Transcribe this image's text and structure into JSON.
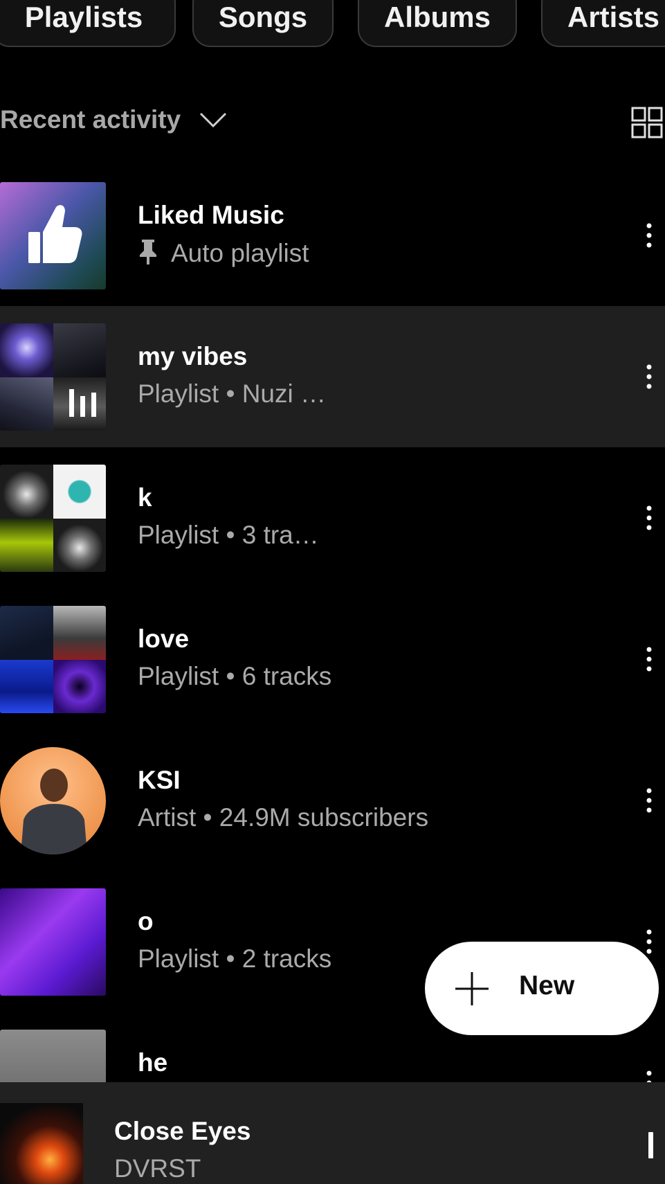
{
  "chips": [
    "Playlists",
    "Songs",
    "Albums",
    "Artists"
  ],
  "section": {
    "sort_label": "Recent activity"
  },
  "items": [
    {
      "title": "Liked Music",
      "subtitle": "Auto playlist",
      "thumb": "liked"
    },
    {
      "title": "my vibes",
      "subtitle": "Playlist • Nuzi …",
      "thumb": "collage-purple",
      "now_playing": true
    },
    {
      "title": "k",
      "subtitle": "Playlist • 3 tra…",
      "thumb": "collage-cyan"
    },
    {
      "title": "love",
      "subtitle": "Playlist • 6 tracks",
      "thumb": "collage-blue"
    },
    {
      "title": "KSI",
      "subtitle": "Artist • 24.9M subscribers",
      "thumb": "artist"
    },
    {
      "title": "o",
      "subtitle": "Playlist • 2 tracks",
      "thumb": "neon"
    },
    {
      "title": "he",
      "subtitle": "",
      "thumb": "grey"
    }
  ],
  "fab": {
    "label": "New",
    "icon": "plus-icon"
  },
  "mini_player": {
    "title": "Close Eyes",
    "artist": "DVRST"
  },
  "colors": {
    "background": "#000000",
    "surface": "#1f1f1f",
    "secondary_text": "#aaaaaa"
  }
}
